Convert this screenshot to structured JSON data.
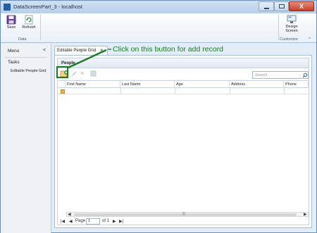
{
  "window": {
    "title": "DataScreenPart_3 - localhost",
    "close_label": "X"
  },
  "ribbon": {
    "save_label": "Save",
    "refresh_label": "Refresh",
    "design_label_1": "Design",
    "design_label_2": "Screen",
    "group_data": "Data",
    "group_customize": "Customize",
    "collapse_label": "^"
  },
  "nav": {
    "menu_label": "Menu",
    "collapse_arrow": "<",
    "tasks_label": "Tasks",
    "items": [
      {
        "label": "Editable People Grid"
      }
    ]
  },
  "tab": {
    "label": "Editable People Grid",
    "close": "×"
  },
  "group": {
    "title": "People"
  },
  "toolbar": {
    "delete_glyph": "×"
  },
  "annotation": {
    "text": "Click on this button for add record",
    "color": "#1b7a22"
  },
  "search": {
    "placeholder": "Search"
  },
  "grid": {
    "columns": [
      {
        "label": "First Name"
      },
      {
        "label": "Last Name"
      },
      {
        "label": "Age"
      },
      {
        "label": "Address"
      },
      {
        "label": "Phone"
      }
    ]
  },
  "pager": {
    "first": "|◀",
    "prev": "◀",
    "page_label": "Page",
    "page_value": "1",
    "of_label": "of 1",
    "next": "▶",
    "last": "▶|"
  },
  "scroll": {
    "left": "◀",
    "right": "▶",
    "grip": "|||"
  }
}
